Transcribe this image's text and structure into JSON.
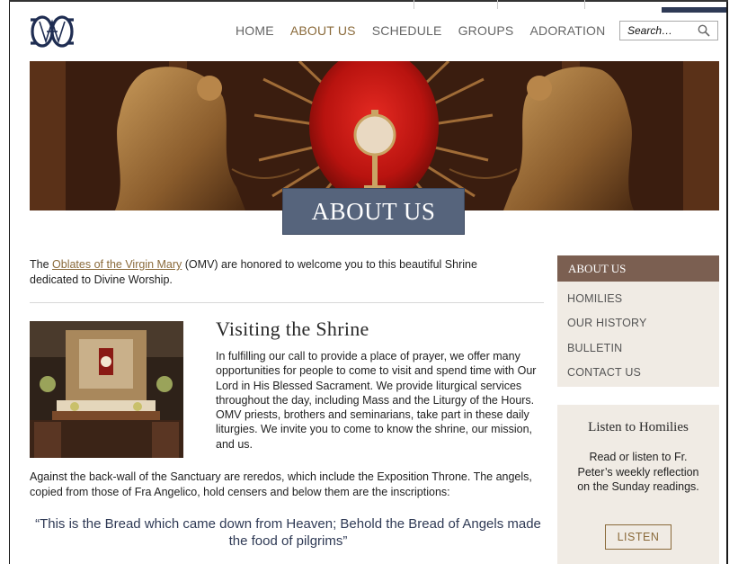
{
  "nav": {
    "items": [
      {
        "label": "HOME"
      },
      {
        "label": "ABOUT US",
        "active": true
      },
      {
        "label": "SCHEDULE"
      },
      {
        "label": "GROUPS"
      },
      {
        "label": "ADORATION"
      }
    ]
  },
  "search": {
    "placeholder": "Search…"
  },
  "hero": {
    "title": "ABOUT US"
  },
  "intro": {
    "prefix": "The ",
    "link": "Oblates of the Virgin Mary",
    "suffix": " (OMV) are honored to welcome you to this beautiful Shrine dedicated to Divine Worship."
  },
  "visiting": {
    "title": "Visiting the Shrine",
    "body": "In fulfilling our call to provide a place of prayer, we offer many opportunities for people to come to visit and spend time with Our Lord in His Blessed Sacrament. We provide liturgical services throughout the day, including Mass and the Liturgy of the Hours. OMV priests, brothers and seminarians, take part in these daily liturgies.  We invite you to come to know the shrine, our mission, and us."
  },
  "sanctuary": {
    "body": "Against the back-wall of the Sanctuary are reredos, which include the Exposition Throne. The angels, copied from those of Fra Angelico, hold censers and below them are the inscriptions:"
  },
  "quote": "“This is the Bread which came down from Heaven; Behold the Bread of Angels made the food of pilgrims”",
  "sidebar": {
    "heading": "ABOUT US",
    "items": [
      {
        "label": "HOMILIES"
      },
      {
        "label": "OUR HISTORY"
      },
      {
        "label": "BULLETIN"
      },
      {
        "label": "CONTACT US"
      }
    ]
  },
  "listen": {
    "title": "Listen to Homilies",
    "text": "Read or listen to Fr. Peter’s weekly reflection on the Sunday readings.",
    "button": "LISTEN"
  },
  "colors": {
    "accent": "#8a6a3a",
    "sidebar_heading": "#7b5f51",
    "sidebar_bg": "#f0ebe4",
    "hero_title_bg": "#56647c",
    "quote": "#2f3a55"
  }
}
